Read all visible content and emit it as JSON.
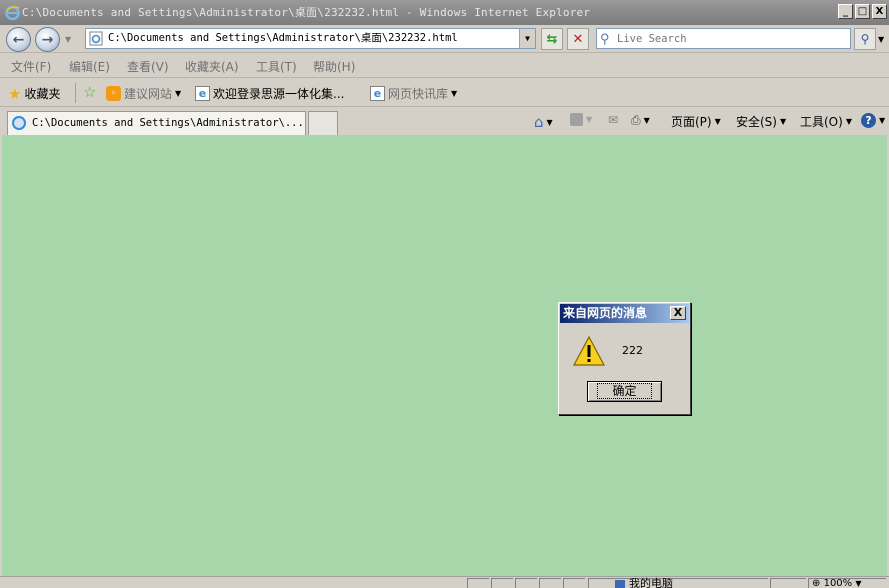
{
  "window": {
    "title": "C:\\Documents and Settings\\Administrator\\桌面\\232232.html - Windows Internet Explorer",
    "minimize_glyph": "_",
    "maximize_glyph": "□",
    "close_glyph": "X"
  },
  "address_bar": {
    "url": "C:\\Documents and Settings\\Administrator\\桌面\\232232.html",
    "search_placeholder": "Live Search"
  },
  "menu": {
    "items": [
      "文件(F)",
      "编辑(E)",
      "查看(V)",
      "收藏夹(A)",
      "工具(T)",
      "帮助(H)"
    ]
  },
  "favorites_bar": {
    "favorites_label": "收藏夹",
    "suggested_sites": "建议网站",
    "link1": "欢迎登录思源一体化集...",
    "web_slice_gallery": "网页快讯库"
  },
  "tabs": [
    {
      "label": "C:\\Documents and Settings\\Administrator\\...",
      "active": true
    }
  ],
  "command_bar": {
    "page": "页面(P)",
    "safety": "安全(S)",
    "tools": "工具(O)"
  },
  "dialog": {
    "title": "来自网页的消息",
    "message": "222",
    "ok_label": "确定",
    "close_glyph": "X"
  },
  "status_bar": {
    "zone": "我的电脑",
    "zoom": "100%"
  },
  "colors": {
    "content_background": "#a8d6ab",
    "chrome": "#d4d0c8",
    "dialog_title_start": "#0a246a",
    "dialog_title_end": "#a6caf0"
  }
}
